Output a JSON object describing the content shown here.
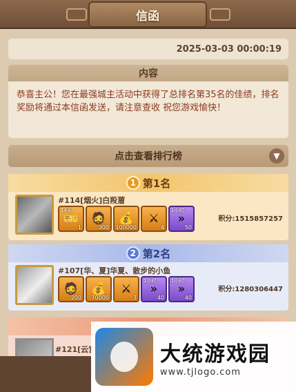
{
  "header": {
    "title": "信函"
  },
  "mail": {
    "timestamp": "2025-03-03 00:00:19",
    "content_title": "内容",
    "body": "恭喜主公！您在最强城主活动中获得了总排名第35名的佳绩，排名奖励将通过本信函发送，请注意查收 祝您游戏愉快！"
  },
  "leaderboard": {
    "toggle_label": "点击查看排行榜",
    "ranks": [
      {
        "rank_label": "第1名",
        "medal": "1",
        "player": "#114[烟火]白羖葿",
        "score": "积分:1515857257",
        "items": [
          {
            "icon": "ticket-icon",
            "tag": "14天",
            "qty": "1",
            "quality": "orange"
          },
          {
            "icon": "hero-card-icon",
            "tag": "",
            "qty": "300",
            "quality": "orange"
          },
          {
            "icon": "gold-ingot-icon",
            "tag": "",
            "qty": "100000",
            "quality": "orange"
          },
          {
            "icon": "crossed-swords-icon",
            "tag": "",
            "qty": "4",
            "quality": "orange"
          },
          {
            "icon": "speedup-icon",
            "tag": "1小时",
            "qty": "50",
            "quality": "purple"
          }
        ]
      },
      {
        "rank_label": "第2名",
        "medal": "2",
        "player": "#107[华、夏]华夏、散步的小鱼",
        "score": "积分:1280306447",
        "items": [
          {
            "icon": "hero-card-icon",
            "tag": "",
            "qty": "200",
            "quality": "orange"
          },
          {
            "icon": "gold-ingot-icon",
            "tag": "",
            "qty": "70000",
            "quality": "orange"
          },
          {
            "icon": "crossed-swords-icon",
            "tag": "",
            "qty": "3",
            "quality": "orange"
          },
          {
            "icon": "speedup-icon",
            "tag": "1小时",
            "qty": "40",
            "quality": "purple"
          },
          {
            "icon": "speedup-icon-2",
            "tag": "1小时",
            "qty": "40",
            "quality": "purple"
          }
        ]
      },
      {
        "rank_label": "",
        "player": "#121[云宫"
      }
    ]
  },
  "watermark": {
    "text": "大统游戏园",
    "url": "www.tjlogo.com"
  },
  "colors": {
    "accent": "#f3c56c",
    "rank2": "#a8b8ea",
    "body_text": "#8a3a1e"
  }
}
